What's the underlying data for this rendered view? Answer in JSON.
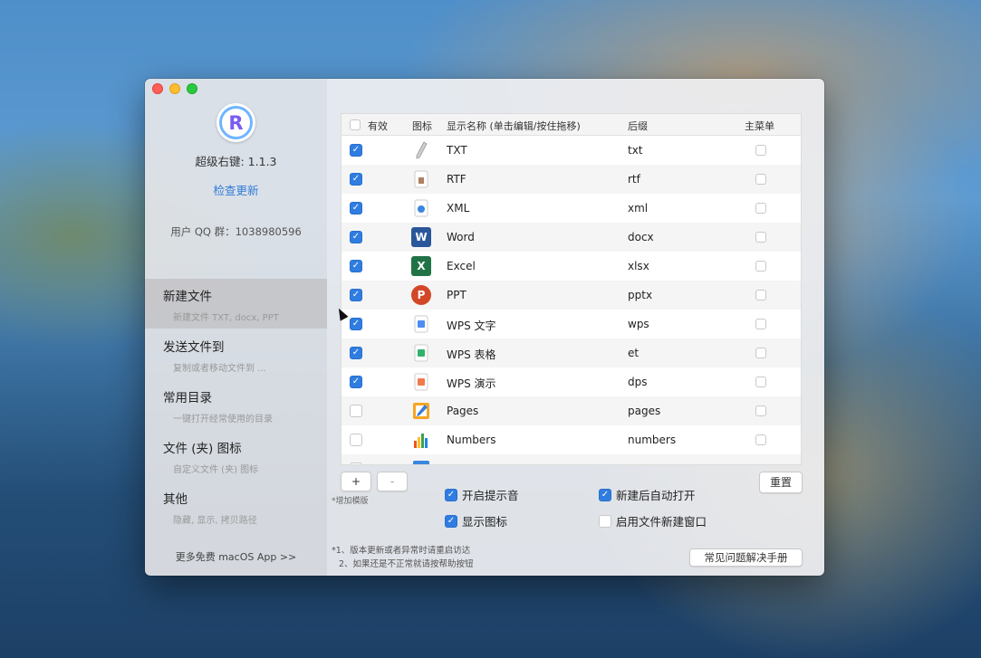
{
  "sidebar": {
    "app_name": "超级右键: 1.1.3",
    "check_update": "检查更新",
    "qq_group": "用户 QQ 群：1038980596",
    "nav": [
      {
        "title": "新建文件",
        "subtitle": "新建文件 TXT, docx, PPT"
      },
      {
        "title": "发送文件到",
        "subtitle": "复制或者移动文件到 ..."
      },
      {
        "title": "常用目录",
        "subtitle": "一键打开经常使用的目录"
      },
      {
        "title": "文件 (夹) 图标",
        "subtitle": "自定义文件 (夹) 图标"
      },
      {
        "title": "其他",
        "subtitle": "隐藏, 显示, 拷贝路径"
      }
    ],
    "more_apps": "更多免费 macOS App >>"
  },
  "table": {
    "headers": {
      "enabled": "有效",
      "icon": "图标",
      "name": "显示名称 (单击编辑/按住拖移)",
      "ext": "后缀",
      "main_menu": "主菜单"
    },
    "rows": [
      {
        "enabled": true,
        "icon": "pen-icon",
        "name": "TXT",
        "ext": "txt"
      },
      {
        "enabled": true,
        "icon": "rtf-file-icon",
        "name": "RTF",
        "ext": "rtf"
      },
      {
        "enabled": true,
        "icon": "xml-file-icon",
        "name": "XML",
        "ext": "xml"
      },
      {
        "enabled": true,
        "icon": "word-icon",
        "name": "Word",
        "ext": "docx"
      },
      {
        "enabled": true,
        "icon": "excel-icon",
        "name": "Excel",
        "ext": "xlsx"
      },
      {
        "enabled": true,
        "icon": "powerpoint-icon",
        "name": "PPT",
        "ext": "pptx"
      },
      {
        "enabled": true,
        "icon": "wps-writer-icon",
        "name": "WPS 文字",
        "ext": "wps"
      },
      {
        "enabled": true,
        "icon": "wps-sheet-icon",
        "name": "WPS 表格",
        "ext": "et"
      },
      {
        "enabled": true,
        "icon": "wps-presentation-icon",
        "name": "WPS 演示",
        "ext": "dps"
      },
      {
        "enabled": false,
        "icon": "pages-icon",
        "name": "Pages",
        "ext": "pages"
      },
      {
        "enabled": false,
        "icon": "numbers-icon",
        "name": "Numbers",
        "ext": "numbers"
      }
    ]
  },
  "icon_glyphs": {
    "word": "W",
    "excel": "X",
    "powerpoint": "P"
  },
  "controls": {
    "add_label": "+",
    "remove_label": "-",
    "add_hint": "*增加模版",
    "reset_label": "重置",
    "options": [
      {
        "label": "开启提示音",
        "checked": true
      },
      {
        "label": "新建后自动打开",
        "checked": true
      },
      {
        "label": "显示图标",
        "checked": true
      },
      {
        "label": "启用文件新建窗口",
        "checked": false
      }
    ],
    "notes": [
      "*1、版本更新或者异常时请重启访达",
      "2、如果还是不正常就请按帮助按钮"
    ],
    "faq_label": "常见问题解决手册"
  },
  "colors": {
    "accent": "#2f7de1",
    "link": "#2f7bd8"
  }
}
